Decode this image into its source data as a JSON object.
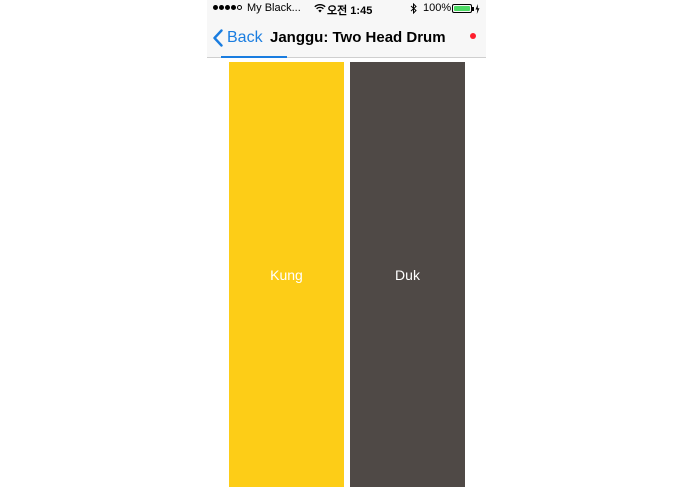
{
  "status_bar": {
    "carrier": "My Black...",
    "time": "오전 1:45",
    "battery_percent": "100%",
    "battery_level": 1.0,
    "icons": [
      "signal-dots-icon",
      "wifi-icon",
      "bluetooth-icon",
      "battery-icon",
      "charging-bolt-icon"
    ]
  },
  "nav": {
    "back_label": "Back",
    "title": "Janggu: Two Head Drum",
    "progress": 0.25
  },
  "pads": {
    "left_label": "Kung",
    "right_label": "Duk"
  },
  "colors": {
    "accent": "#1a7de0",
    "kung_pad": "#fdcd17",
    "duk_pad": "#4f4946",
    "recording": "#ff1e2d",
    "battery": "#4cd964"
  }
}
